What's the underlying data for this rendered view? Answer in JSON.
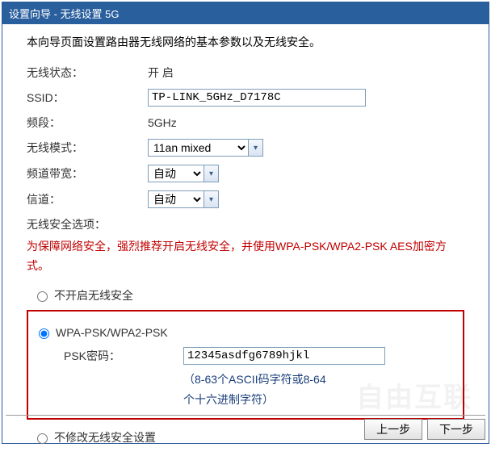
{
  "title": "设置向导 - 无线设置 5G",
  "intro": "本向导页面设置路由器无线网络的基本参数以及无线安全。",
  "fields": {
    "status_label": "无线状态：",
    "status_value": "开 启",
    "ssid_label": "SSID：",
    "ssid_value": "TP-LINK_5GHz_D7178C",
    "band_label": "频段：",
    "band_value": "5GHz",
    "mode_label": "无线模式：",
    "mode_value": "11an mixed",
    "bw_label": "频道带宽：",
    "bw_value": "自动",
    "channel_label": "信道：",
    "channel_value": "自动"
  },
  "security": {
    "section_label": "无线安全选项：",
    "warning": "为保障网络安全，强烈推荐开启无线安全，并使用WPA-PSK/WPA2-PSK AES加密方式。",
    "opt_off": "不开启无线安全",
    "opt_wpa": "WPA-PSK/WPA2-PSK",
    "psk_label": "PSK密码：",
    "psk_value": "12345asdfg6789hjkl",
    "psk_hint1": "（8-63个ASCII码字符或8-64",
    "psk_hint2": "个十六进制字符）",
    "opt_keep": "不修改无线安全设置"
  },
  "buttons": {
    "prev": "上一步",
    "next": "下一步"
  },
  "watermark": "自由互联"
}
